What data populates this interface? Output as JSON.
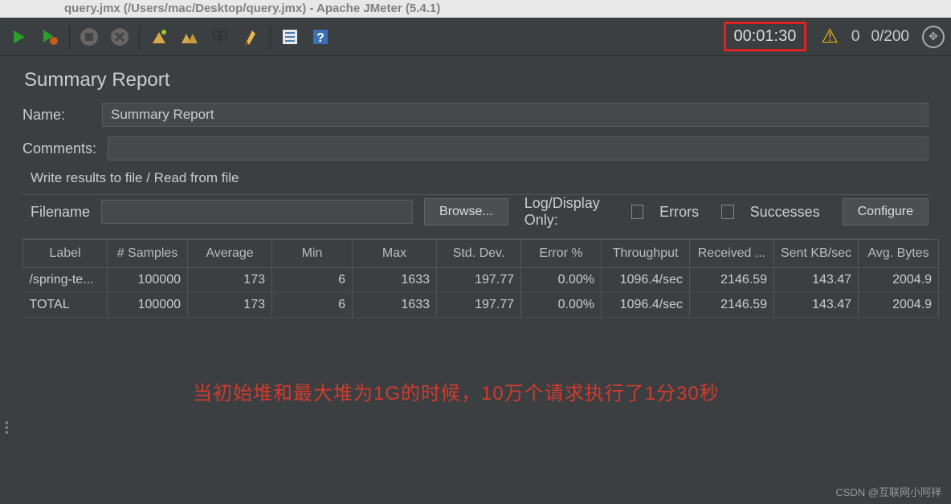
{
  "titlebar": "query.jmx (/Users/mac/Desktop/query.jmx) - Apache JMeter (5.4.1)",
  "toolbar": {
    "timer": "00:01:30",
    "warn_count": "0",
    "thread_ratio": "0/200"
  },
  "panel": {
    "title": "Summary Report",
    "name_label": "Name:",
    "name_value": "Summary Report",
    "comments_label": "Comments:",
    "comments_value": "",
    "fieldset": "Write results to file / Read from file",
    "filename_label": "Filename",
    "filename_value": "",
    "browse_btn": "Browse...",
    "log_label": "Log/Display Only:",
    "errors_label": "Errors",
    "successes_label": "Successes",
    "configure_btn": "Configure"
  },
  "table": {
    "headers": [
      "Label",
      "# Samples",
      "Average",
      "Min",
      "Max",
      "Std. Dev.",
      "Error %",
      "Throughput",
      "Received ...",
      "Sent KB/sec",
      "Avg. Bytes"
    ],
    "rows": [
      [
        "/spring-te...",
        "100000",
        "173",
        "6",
        "1633",
        "197.77",
        "0.00%",
        "1096.4/sec",
        "2146.59",
        "143.47",
        "2004.9"
      ],
      [
        "TOTAL",
        "100000",
        "173",
        "6",
        "1633",
        "197.77",
        "0.00%",
        "1096.4/sec",
        "2146.59",
        "143.47",
        "2004.9"
      ]
    ]
  },
  "annotation": "当初始堆和最大堆为1G的时候，10万个请求执行了1分30秒",
  "watermark": "CSDN @互联网小阿祥"
}
